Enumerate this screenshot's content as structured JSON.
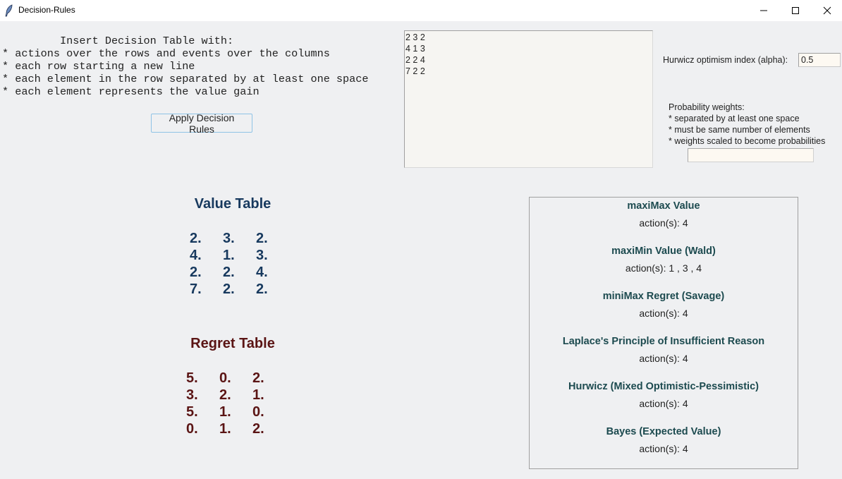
{
  "window": {
    "title": "Decision-Rules",
    "icon": "feather-icon",
    "controls": [
      "minimize",
      "maximize",
      "close"
    ]
  },
  "instructions": {
    "heading": "         Insert Decision Table with:",
    "lines": [
      "* actions over the rows and events over the columns",
      "* each row starting a new line",
      "* each element in the row separated by at least one space",
      "* each element represents the value gain"
    ]
  },
  "apply_button": {
    "label": "Apply Decision Rules"
  },
  "decision_input": {
    "value": "2 3 2\n4 1 3\n2 2 4\n7 2 2"
  },
  "hurwicz": {
    "label": "Hurwicz optimism index (alpha):",
    "value": "0.5"
  },
  "probability": {
    "heading": "Probability weights:",
    "lines": [
      "* separated by at least one space",
      "* must be same number of elements",
      "* weights scaled to become probabilities"
    ],
    "value": ""
  },
  "value_table": {
    "title": "Value Table",
    "rows": [
      [
        "2.",
        "3.",
        "2."
      ],
      [
        "4.",
        "1.",
        "3."
      ],
      [
        "2.",
        "2.",
        "4."
      ],
      [
        "7.",
        "2.",
        "2."
      ]
    ]
  },
  "regret_table": {
    "title": "Regret Table",
    "rows": [
      [
        "5.",
        "0.",
        "2."
      ],
      [
        "3.",
        "2.",
        "1."
      ],
      [
        "5.",
        "1.",
        "0."
      ],
      [
        "0.",
        "1.",
        "2."
      ]
    ]
  },
  "results": [
    {
      "name": "maxiMax Value",
      "actions": "action(s):  4"
    },
    {
      "name": "maxiMin Value (Wald)",
      "actions": "action(s):  1 ,  3 ,  4"
    },
    {
      "name": "miniMax Regret (Savage)",
      "actions": "action(s):  4"
    },
    {
      "name": "Laplace's Principle of Insufficient Reason",
      "actions": "action(s):  4"
    },
    {
      "name": "Hurwicz (Mixed Optimistic-Pessimistic)",
      "actions": "action(s):  4"
    },
    {
      "name": "Bayes (Expected Value)",
      "actions": "action(s):  4"
    }
  ]
}
